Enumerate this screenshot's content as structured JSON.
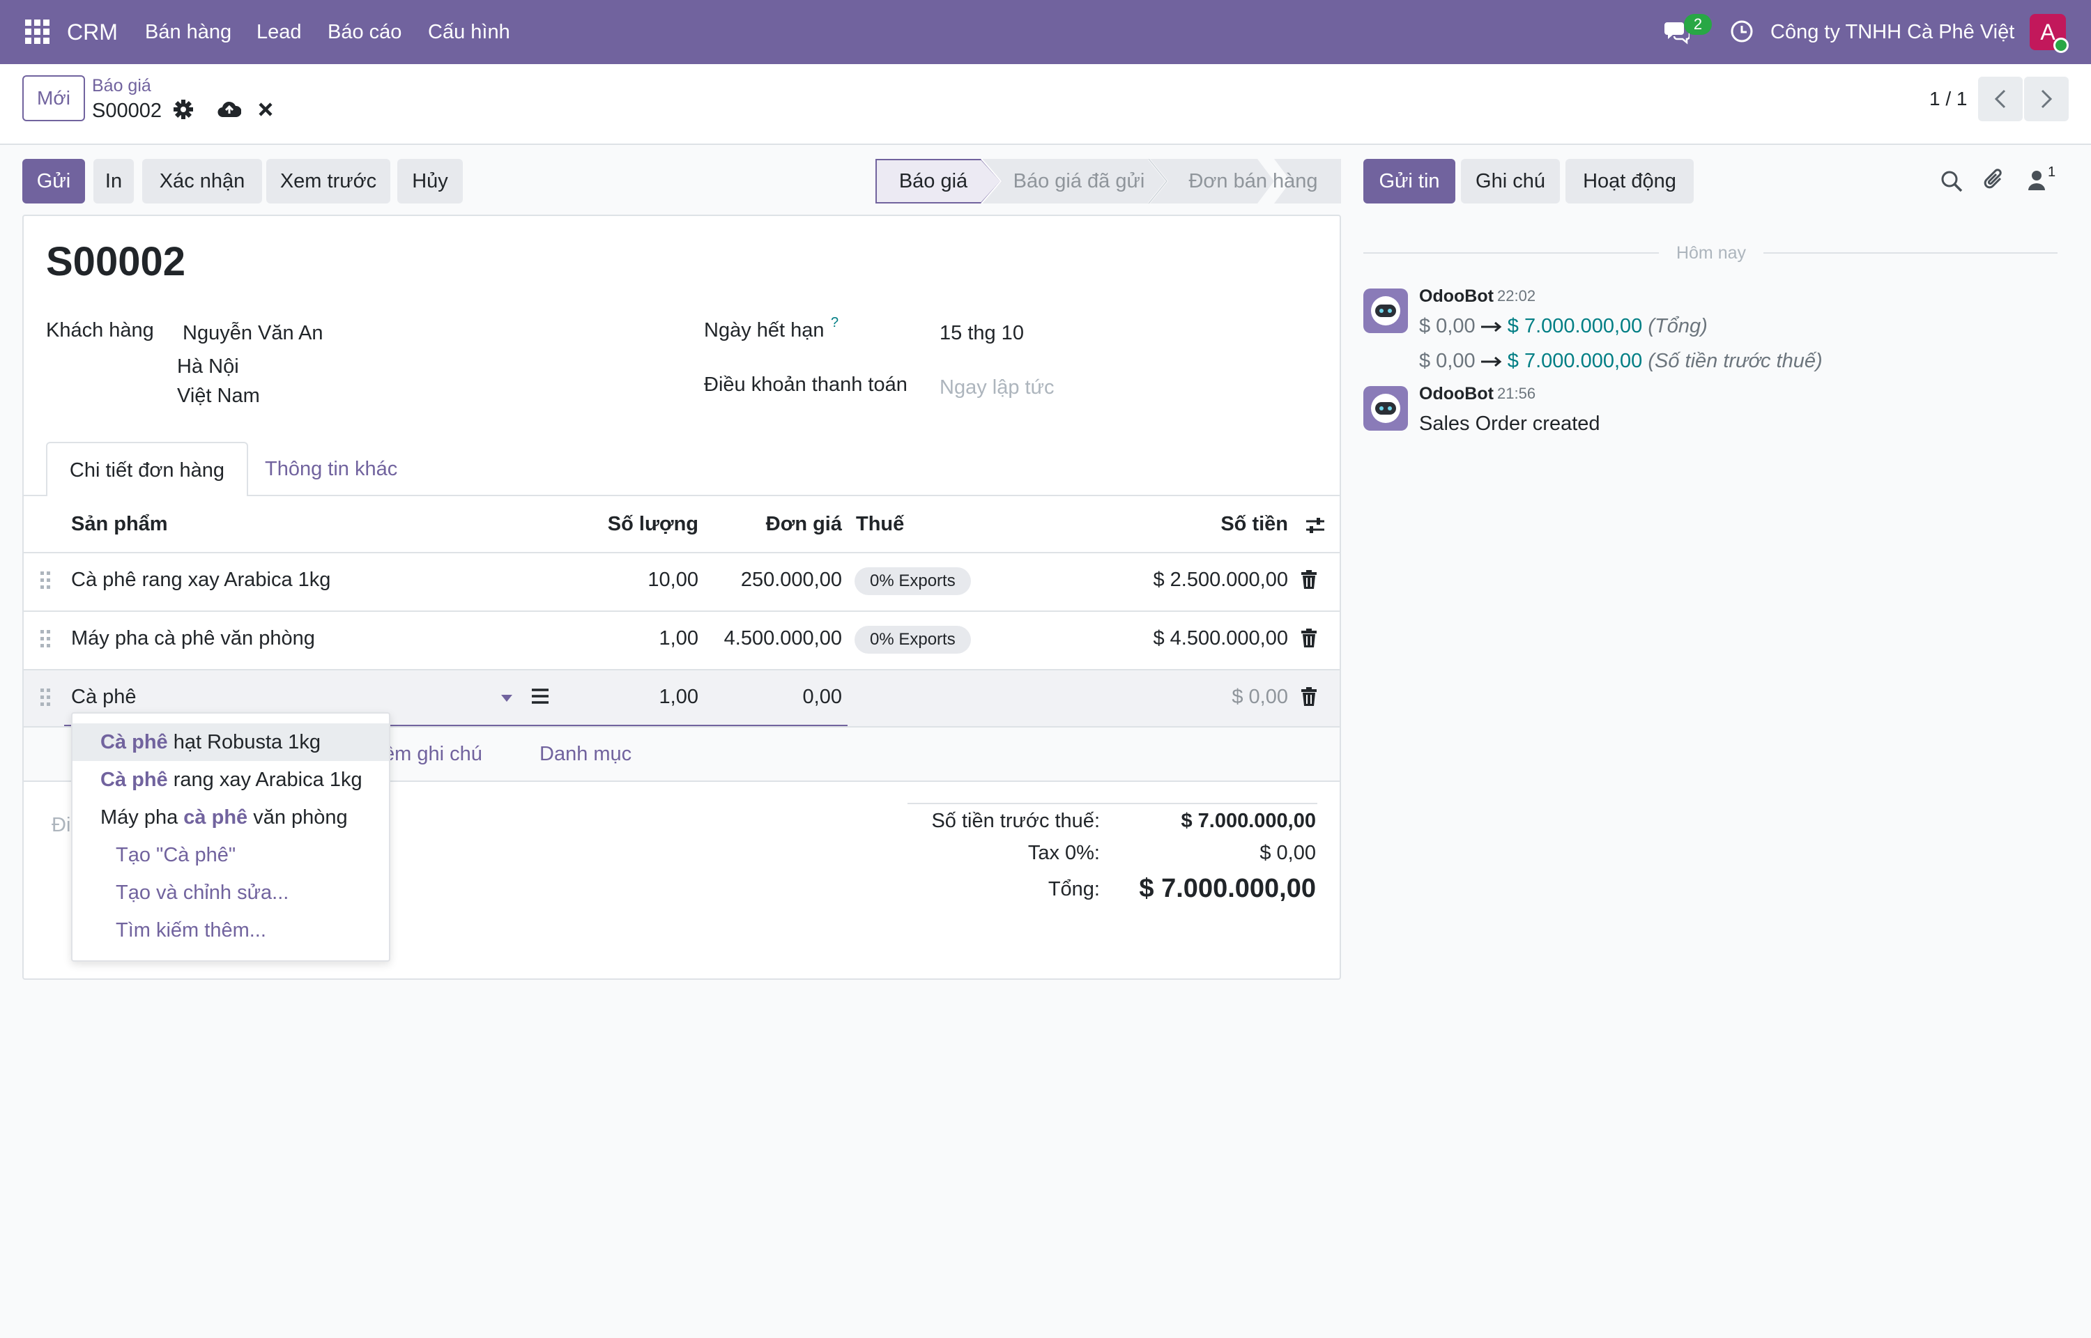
{
  "navbar": {
    "app_name": "CRM",
    "menu": [
      "Bán hàng",
      "Lead",
      "Báo cáo",
      "Cấu hình"
    ],
    "chat_count": "2",
    "company": "Công ty TNHH Cà Phê Việt",
    "avatar_initial": "A"
  },
  "control_panel": {
    "new_button": "Mới",
    "breadcrumb_parent": "Báo giá",
    "breadcrumb_current": "S00002",
    "pager": "1 / 1"
  },
  "actions": {
    "send": "Gửi",
    "print": "In",
    "confirm": "Xác nhận",
    "preview": "Xem trước",
    "cancel": "Hủy"
  },
  "statusbar": {
    "steps": [
      "Báo giá",
      "Báo giá đã gửi",
      "Đơn bán hàng"
    ],
    "active_index": 0
  },
  "form": {
    "name": "S00002",
    "customer_label": "Khách hàng",
    "customer_name": "Nguyễn Văn An",
    "customer_city": "Hà Nội",
    "customer_country": "Việt Nam",
    "expiry_label": "Ngày hết hạn",
    "expiry_help": "?",
    "expiry_value": "15 thg 10",
    "payment_terms_label": "Điều khoản thanh toán",
    "payment_terms_placeholder": "Ngay lập tức"
  },
  "tabs": {
    "order_lines": "Chi tiết đơn hàng",
    "other_info": "Thông tin khác"
  },
  "table": {
    "headers": {
      "product": "Sản phẩm",
      "quantity": "Số lượng",
      "unit_price": "Đơn giá",
      "taxes": "Thuế",
      "subtotal": "Số tiền"
    },
    "rows": [
      {
        "product": "Cà phê rang xay Arabica 1kg",
        "quantity": "10,00",
        "unit_price": "250.000,00",
        "tax": "0% Exports",
        "subtotal": "$ 2.500.000,00"
      },
      {
        "product": "Máy pha cà phê văn phòng",
        "quantity": "1,00",
        "unit_price": "4.500.000,00",
        "tax": "0% Exports",
        "subtotal": "$ 4.500.000,00"
      },
      {
        "product": "Cà phê",
        "quantity": "1,00",
        "unit_price": "0,00",
        "tax": "",
        "subtotal": "$ 0,00"
      }
    ],
    "add_note_partial": "êm ghi chú",
    "add_section": "Danh mục",
    "terms_partial": "Đi"
  },
  "dropdown": {
    "items": [
      {
        "match": "Cà phê",
        "before": "",
        "after": " hạt Robusta 1kg"
      },
      {
        "match": "Cà phê",
        "before": "",
        "after": " rang xay Arabica 1kg"
      },
      {
        "match": "cà phê",
        "before": "Máy pha ",
        "after": " văn phòng"
      }
    ],
    "create": "Tạo \"Cà phê\"",
    "create_edit": "Tạo và chỉnh sửa...",
    "search_more": "Tìm kiếm thêm..."
  },
  "totals": {
    "untaxed_label": "Số tiền trước thuế:",
    "untaxed_value": "$ 7.000.000,00",
    "tax_label": "Tax 0%:",
    "tax_value": "$ 0,00",
    "total_label": "Tổng:",
    "total_value": "$ 7.000.000,00"
  },
  "chatter": {
    "send_message": "Gửi tin",
    "log_note": "Ghi chú",
    "activities": "Hoạt động",
    "followers_count": "1",
    "today": "Hôm nay",
    "messages": [
      {
        "author": "OdooBot",
        "time": "22:02",
        "tracking": [
          {
            "old": "$ 0,00",
            "new": "$ 7.000.000,00",
            "field": "(Tổng)"
          },
          {
            "old": "$ 0,00",
            "new": "$ 7.000.000,00",
            "field": "(Số tiền trước thuế)"
          }
        ]
      },
      {
        "author": "OdooBot",
        "time": "21:56",
        "body": "Sales Order created"
      }
    ]
  },
  "colors": {
    "brand": "#71639e",
    "tracking_new": "#017e84",
    "status_online": "#28a745"
  }
}
